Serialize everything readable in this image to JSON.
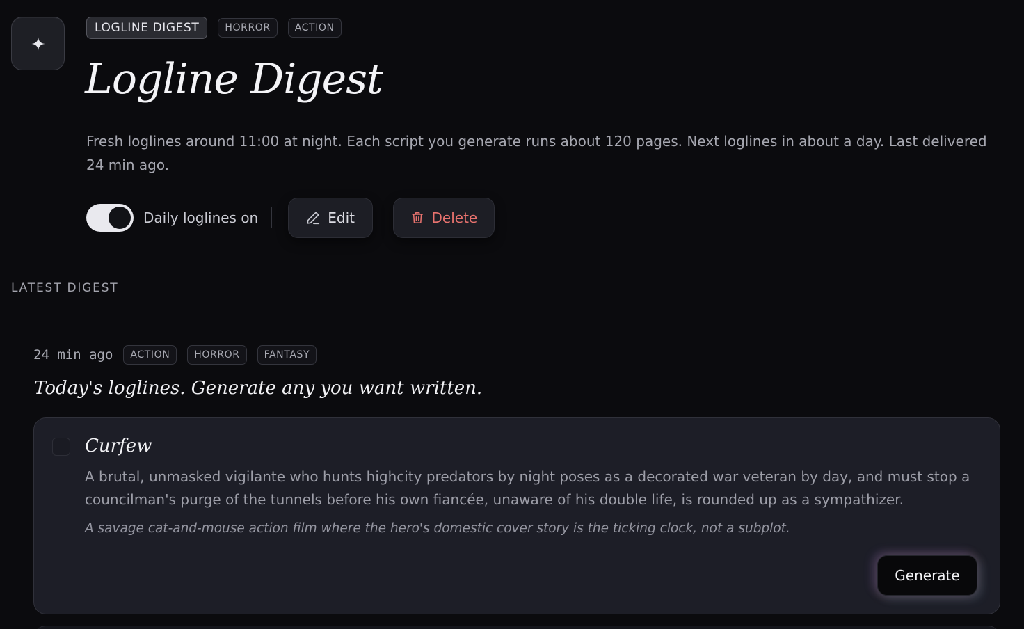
{
  "header": {
    "tags": [
      "LOGLINE DIGEST",
      "HORROR",
      "ACTION"
    ],
    "title": "Logline Digest",
    "description": "Fresh loglines around 11:00 at night. Each script you generate runs about 120 pages. Next loglines in about a day. Last delivered 24 min ago."
  },
  "controls": {
    "toggle_label": "Daily loglines on",
    "toggle_on": true,
    "edit_label": "Edit",
    "delete_label": "Delete"
  },
  "colors": {
    "background": "#0b0b0e",
    "card": "#1d1e27",
    "delete_accent": "#e7726e",
    "toggle_track": "#e9e9ee"
  },
  "latest": {
    "section_label": "LATEST DIGEST",
    "timestamp": "24 min ago",
    "tags": [
      "ACTION",
      "HORROR",
      "FANTASY"
    ],
    "heading": "Today's loglines. Generate any you want written.",
    "items": [
      {
        "title": "Curfew",
        "logline": "A brutal, unmasked vigilante who hunts highcity predators by night poses as a decorated war veteran by day, and must stop a councilman's purge of the tunnels before his own fiancée, unaware of his double life, is rounded up as a sympathizer.",
        "note": "A savage cat-and-mouse action film where the hero's domestic cover story is the ticking clock, not a subplot.",
        "selected": false,
        "generate_label": "Generate"
      }
    ]
  }
}
